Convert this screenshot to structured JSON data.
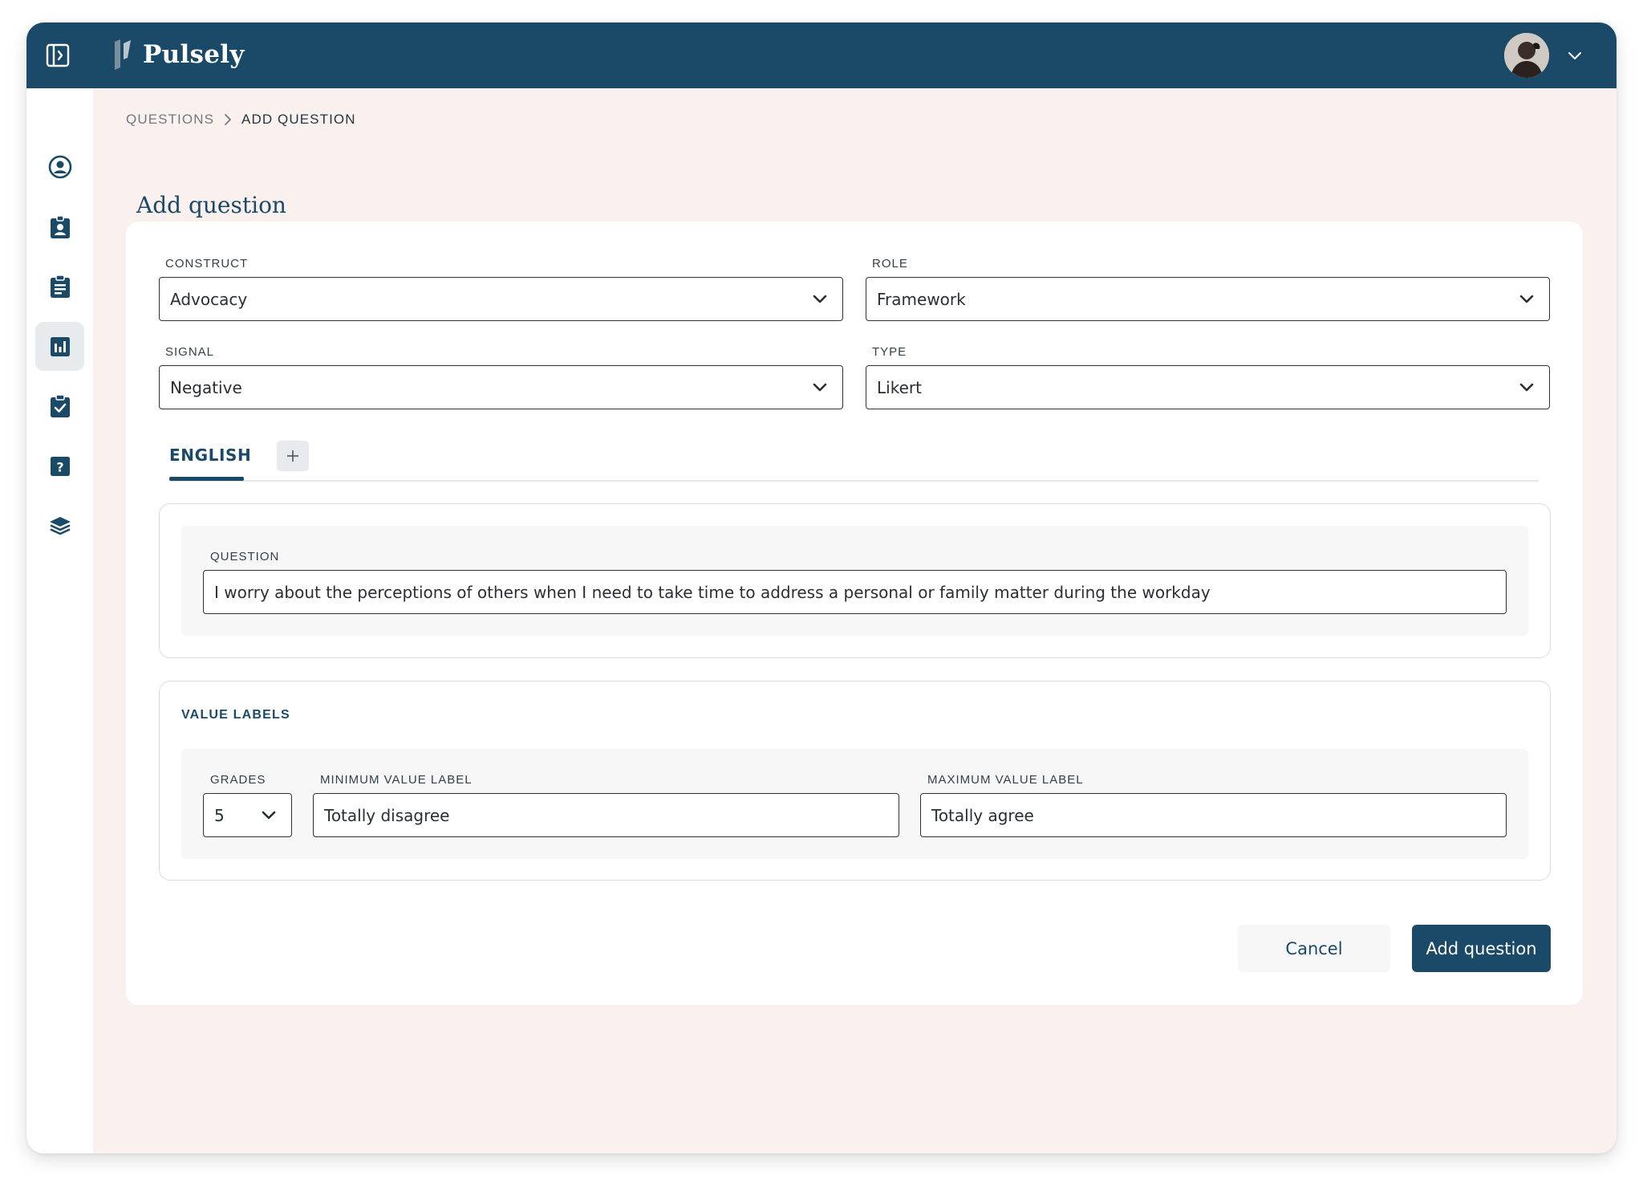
{
  "app": {
    "brand": "Pulsely",
    "brand_color": "#1a4a67",
    "background_color": "#faf0ee"
  },
  "topbar": {
    "sidebar_toggle_icon": "sidebar-toggle-icon",
    "avatar_icon": "user-avatar",
    "avatar_menu_icon": "chevron-down-icon"
  },
  "sidebar": {
    "items": [
      {
        "icon": "user-circle-icon",
        "active": false
      },
      {
        "icon": "badge-icon",
        "active": false
      },
      {
        "icon": "clipboard-icon",
        "active": false
      },
      {
        "icon": "bar-chart-icon",
        "active": true
      },
      {
        "icon": "clipboard-check-icon",
        "active": false
      },
      {
        "icon": "help-square-icon",
        "active": false
      },
      {
        "icon": "layers-icon",
        "active": false
      }
    ]
  },
  "breadcrumb": {
    "parent": "QUESTIONS",
    "current": "ADD QUESTION"
  },
  "page": {
    "title": "Add question"
  },
  "form": {
    "construct": {
      "label": "CONSTRUCT",
      "value": "Advocacy"
    },
    "role": {
      "label": "ROLE",
      "value": "Framework"
    },
    "signal": {
      "label": "SIGNAL",
      "value": "Negative"
    },
    "type": {
      "label": "TYPE",
      "value": "Likert"
    },
    "tabs": {
      "active": "ENGLISH",
      "add_icon": "plus-icon"
    },
    "question": {
      "label": "QUESTION",
      "value": "I worry about the perceptions of others when I need to take time to address a personal or family matter during the workday"
    },
    "value_labels": {
      "title": "VALUE LABELS",
      "grades": {
        "label": "GRADES",
        "value": "5"
      },
      "min": {
        "label": "MINIMUM VALUE LABEL",
        "value": "Totally disagree"
      },
      "max": {
        "label": "MAXIMUM VALUE LABEL",
        "value": "Totally agree"
      }
    },
    "buttons": {
      "cancel": "Cancel",
      "submit": "Add question"
    }
  }
}
